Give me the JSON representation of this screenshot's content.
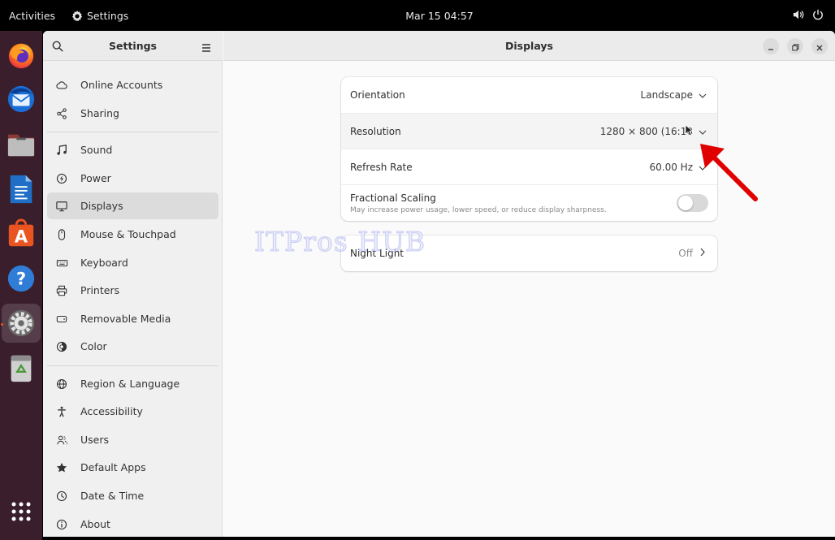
{
  "topbar": {
    "activities": "Activities",
    "app_name": "Settings",
    "clock": "Mar 15  04:57"
  },
  "dock": {
    "items": [
      {
        "name": "firefox-icon"
      },
      {
        "name": "thunderbird-icon"
      },
      {
        "name": "files-icon"
      },
      {
        "name": "libreoffice-writer-icon"
      },
      {
        "name": "app-center-icon"
      },
      {
        "name": "help-icon"
      },
      {
        "name": "settings-icon"
      },
      {
        "name": "trash-icon"
      }
    ],
    "active_color": "#e95420"
  },
  "sidebar": {
    "title": "Settings",
    "items": [
      {
        "label": "Online Accounts",
        "icon": "cloud-icon"
      },
      {
        "label": "Sharing",
        "icon": "share-icon"
      },
      {
        "label": "Sound",
        "icon": "music-note-icon"
      },
      {
        "label": "Power",
        "icon": "power-icon"
      },
      {
        "label": "Displays",
        "icon": "monitor-icon",
        "active": true
      },
      {
        "label": "Mouse & Touchpad",
        "icon": "mouse-icon"
      },
      {
        "label": "Keyboard",
        "icon": "keyboard-icon"
      },
      {
        "label": "Printers",
        "icon": "printer-icon"
      },
      {
        "label": "Removable Media",
        "icon": "removable-media-icon"
      },
      {
        "label": "Color",
        "icon": "color-icon"
      },
      {
        "label": "Region & Language",
        "icon": "globe-icon"
      },
      {
        "label": "Accessibility",
        "icon": "accessibility-icon"
      },
      {
        "label": "Users",
        "icon": "users-icon"
      },
      {
        "label": "Default Apps",
        "icon": "star-icon"
      },
      {
        "label": "Date & Time",
        "icon": "clock-icon"
      },
      {
        "label": "About",
        "icon": "info-icon"
      }
    ]
  },
  "content": {
    "title": "Displays",
    "orientation": {
      "label": "Orientation",
      "value": "Landscape"
    },
    "resolution": {
      "label": "Resolution",
      "value": "1280 × 800 (16:10"
    },
    "refresh_rate": {
      "label": "Refresh Rate",
      "value": "60.00 Hz"
    },
    "fractional_scaling": {
      "label": "Fractional Scaling",
      "description": "May increase power usage, lower speed, or reduce display sharpness.",
      "enabled": false
    },
    "night_light": {
      "label": "Night Light",
      "value": "Off"
    }
  },
  "watermark": "ITPros HUB",
  "annotation_arrow_color": "#e00000"
}
